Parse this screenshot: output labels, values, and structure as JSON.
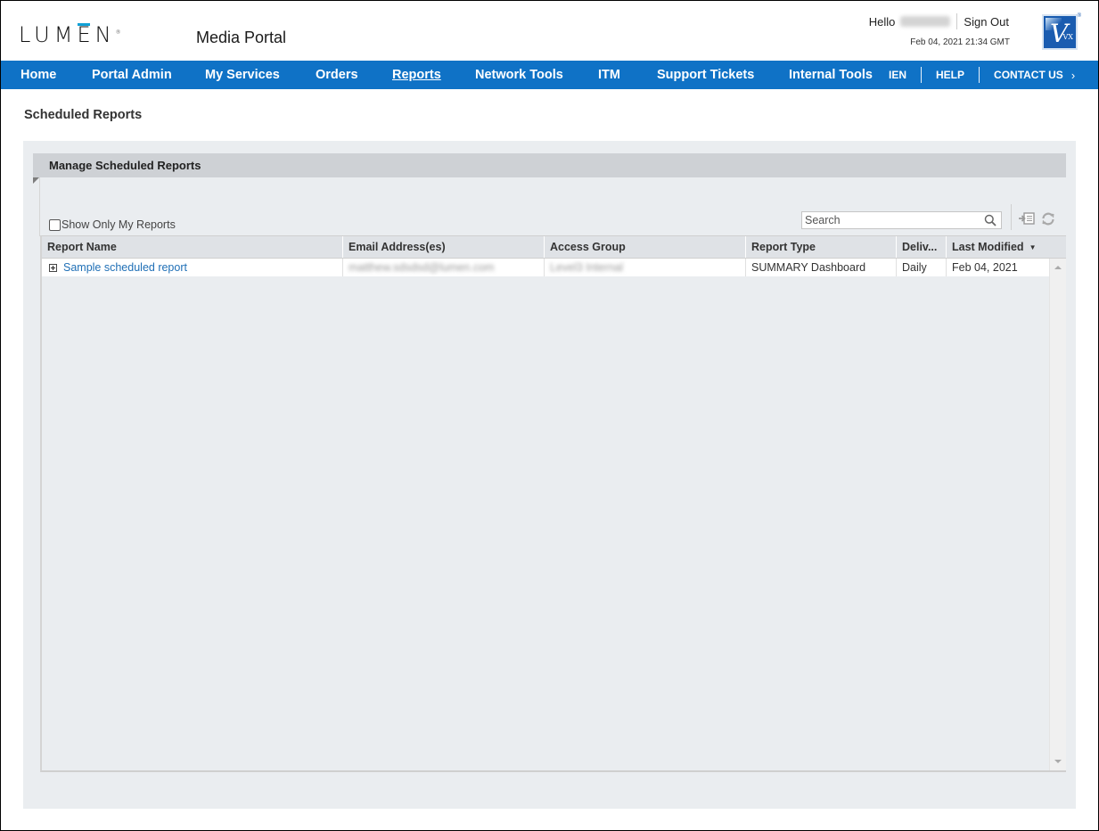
{
  "header": {
    "brand": "LUMEN",
    "portal_title": "Media Portal",
    "greeting": "Hello",
    "user_name": "Matthew",
    "sign_out_label": "Sign Out",
    "timestamp": "Feb 04, 2021 21:34 GMT",
    "partner_logo": "Vyvx"
  },
  "nav": {
    "items": [
      {
        "label": "Home"
      },
      {
        "label": "Portal Admin"
      },
      {
        "label": "My Services"
      },
      {
        "label": "Orders"
      },
      {
        "label": "Reports",
        "active": true
      },
      {
        "label": "Network Tools"
      },
      {
        "label": "ITM"
      },
      {
        "label": "Support Tickets"
      },
      {
        "label": "Internal Tools"
      }
    ],
    "right_items": [
      {
        "label": "IEN"
      },
      {
        "label": "HELP"
      },
      {
        "label": "CONTACT US"
      }
    ],
    "accent_color": "#0f72c6"
  },
  "page": {
    "title": "Scheduled Reports",
    "panel_title": "Manage Scheduled Reports",
    "show_only_mine_label": "Show Only My Reports",
    "show_only_mine_checked": false,
    "search_placeholder": "Search",
    "search_value": ""
  },
  "toolbar": {
    "export_icon": "export-icon",
    "refresh_icon": "refresh-icon"
  },
  "grid": {
    "columns": [
      {
        "label": "Report Name"
      },
      {
        "label": "Email Address(es)"
      },
      {
        "label": "Access Group"
      },
      {
        "label": "Report Type"
      },
      {
        "label": "Deliv..."
      },
      {
        "label": "Last Modified",
        "sort": "desc"
      }
    ],
    "rows": [
      {
        "report_name": "Sample scheduled report",
        "email": "matthew.sdsdsd@lumen.com",
        "access_group": "Level3 Internal",
        "report_type": "SUMMARY Dashboard",
        "delivery": "Daily",
        "last_modified": "Feb 04, 2021"
      }
    ],
    "sort_indicator": "▼"
  }
}
